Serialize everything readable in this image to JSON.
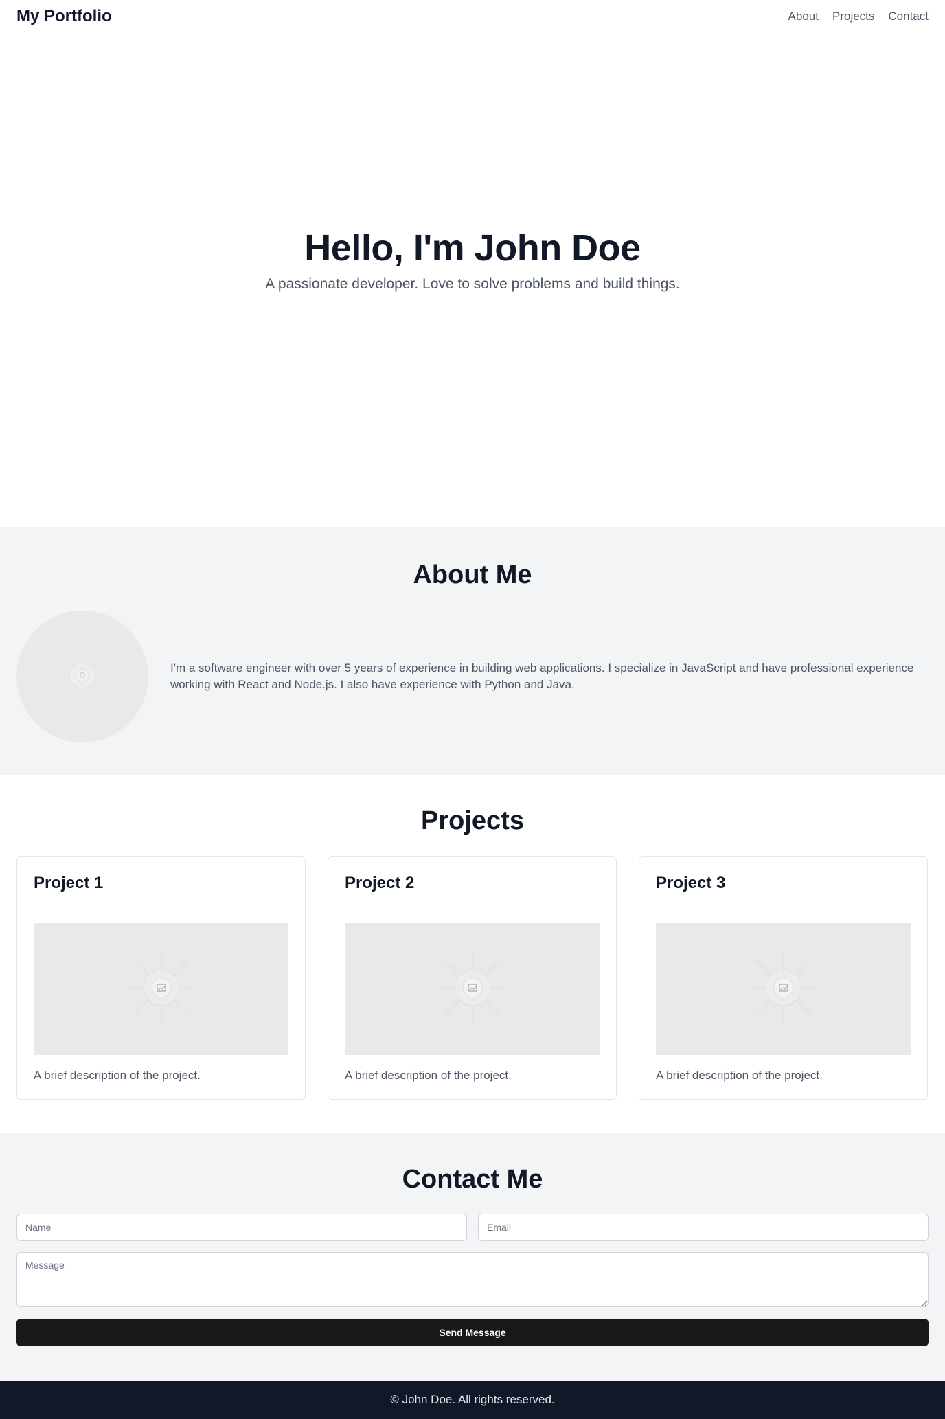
{
  "header": {
    "brand": "My Portfolio",
    "nav": [
      {
        "label": "About"
      },
      {
        "label": "Projects"
      },
      {
        "label": "Contact"
      }
    ]
  },
  "hero": {
    "title": "Hello, I'm John Doe",
    "subtitle": "A passionate developer. Love to solve problems and build things."
  },
  "about": {
    "heading": "About Me",
    "avatar_icon": "image-placeholder-icon",
    "text": "I'm a software engineer with over 5 years of experience in building web applications. I specialize in JavaScript and have professional experience working with React and Node.js. I also have experience with Python and Java."
  },
  "projects": {
    "heading": "Projects",
    "items": [
      {
        "title": "Project 1",
        "image_icon": "image-placeholder-icon",
        "description": "A brief description of the project."
      },
      {
        "title": "Project 2",
        "image_icon": "image-placeholder-icon",
        "description": "A brief description of the project."
      },
      {
        "title": "Project 3",
        "image_icon": "image-placeholder-icon",
        "description": "A brief description of the project."
      }
    ]
  },
  "contact": {
    "heading": "Contact Me",
    "name_placeholder": "Name",
    "email_placeholder": "Email",
    "message_placeholder": "Message",
    "send_label": "Send Message"
  },
  "footer": {
    "text": "© John Doe. All rights reserved."
  },
  "colors": {
    "text_dark": "#111827",
    "text_muted": "#4b5563",
    "section_alt_bg": "#f3f4f6",
    "placeholder_bg": "#e9e9e9",
    "button_bg": "#18181b",
    "footer_bg": "#111827"
  }
}
